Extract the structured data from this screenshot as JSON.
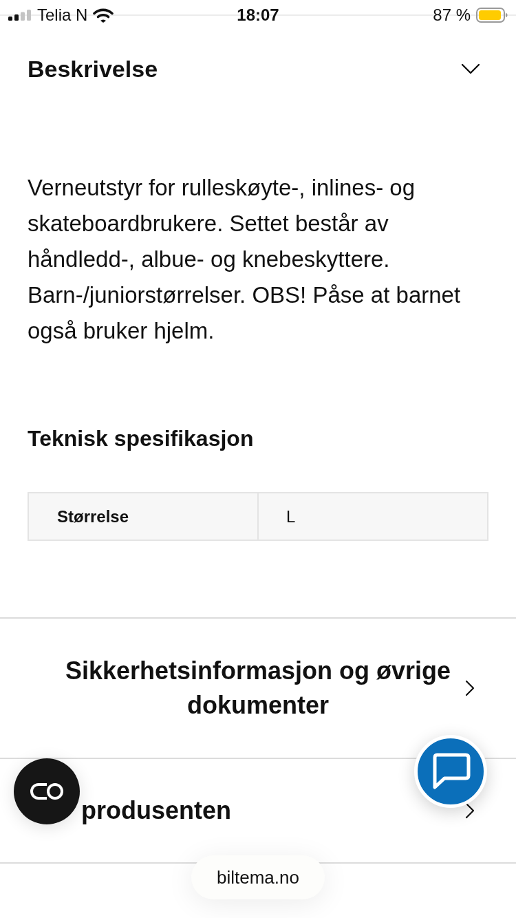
{
  "status_bar": {
    "carrier": "Telia N",
    "time": "18:07",
    "battery": "87 %"
  },
  "description": {
    "title": "Beskrivelse",
    "text": "Verneutstyr for rulleskøyte-, inlines- og skateboardbrukere. Settet består av håndledd-, albue- og knebeskyttere. Barn-/juniorstørrelser. OBS! Påse at barnet også bruker hjelm."
  },
  "specification": {
    "title": "Teknisk spesifikasjon",
    "rows": [
      {
        "label": "Størrelse",
        "value": "L"
      }
    ]
  },
  "links": [
    "Sikkerhetsinformasjon og øvrige dokumenter",
    "produsenten"
  ],
  "address_bar": {
    "domain": "biltema.no"
  }
}
